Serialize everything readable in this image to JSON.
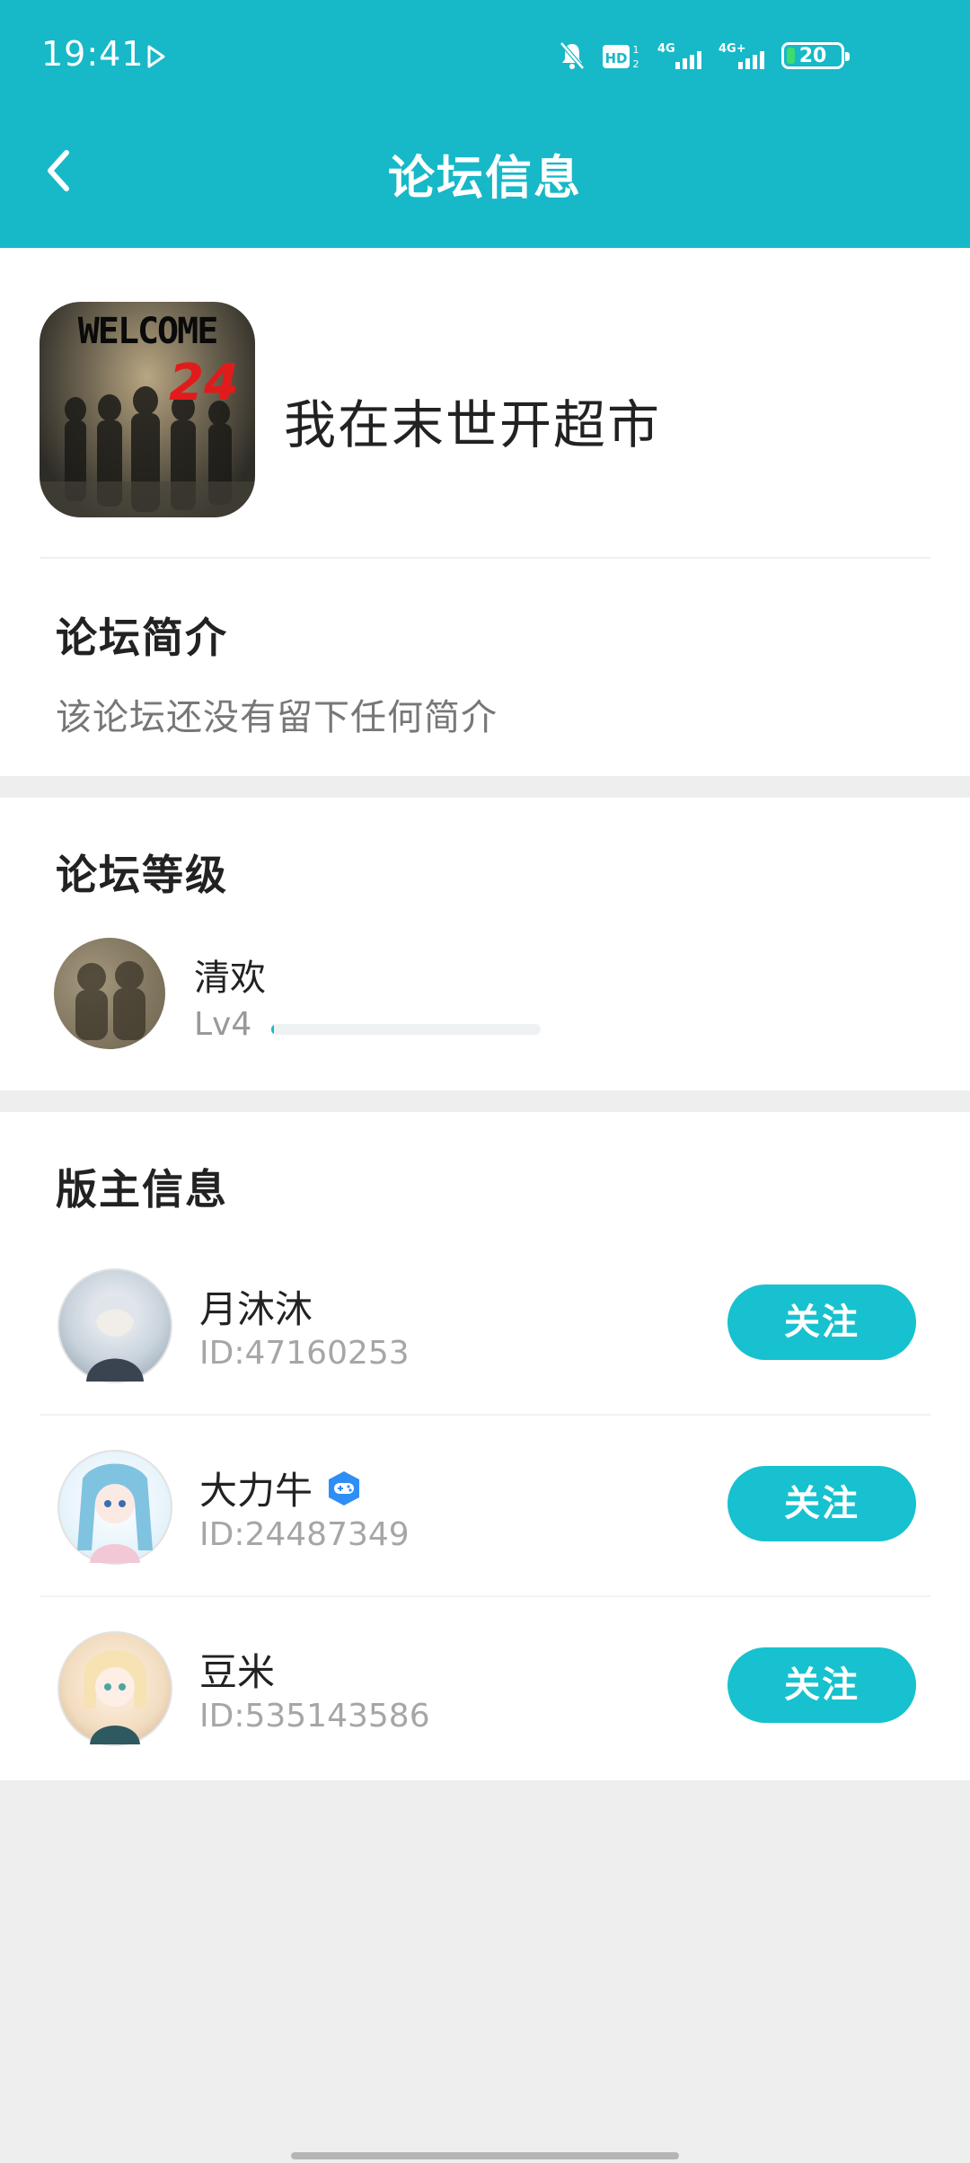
{
  "status_bar": {
    "time": "19:41",
    "battery_level": "20",
    "icons": [
      "play-icon",
      "mute-icon",
      "hd-icon",
      "signal-4g-icon",
      "signal-4g-plus-icon",
      "battery-icon"
    ]
  },
  "header": {
    "title": "论坛信息",
    "back_icon": "chevron-left-icon"
  },
  "forum": {
    "icon_text_line1": "WELCOME",
    "icon_text_line2": "24",
    "name": "我在末世开超市"
  },
  "intro": {
    "title": "论坛简介",
    "text": "该论坛还没有留下任何简介"
  },
  "level": {
    "title": "论坛等级",
    "user_name": "清欢",
    "level_label": "Lv4",
    "progress": 0.01
  },
  "moderators": {
    "title": "版主信息",
    "follow_label": "关注",
    "items": [
      {
        "name": "月沐沐",
        "id": "ID:47160253",
        "badge": false
      },
      {
        "name": "大力牛",
        "id": "ID:24487349",
        "badge": true
      },
      {
        "name": "豆米",
        "id": "ID:535143586",
        "badge": false
      }
    ]
  },
  "colors": {
    "accent": "#17b8c8",
    "button": "#17c1cf",
    "background": "#eeeeee",
    "badge": "#2f8ef5"
  }
}
